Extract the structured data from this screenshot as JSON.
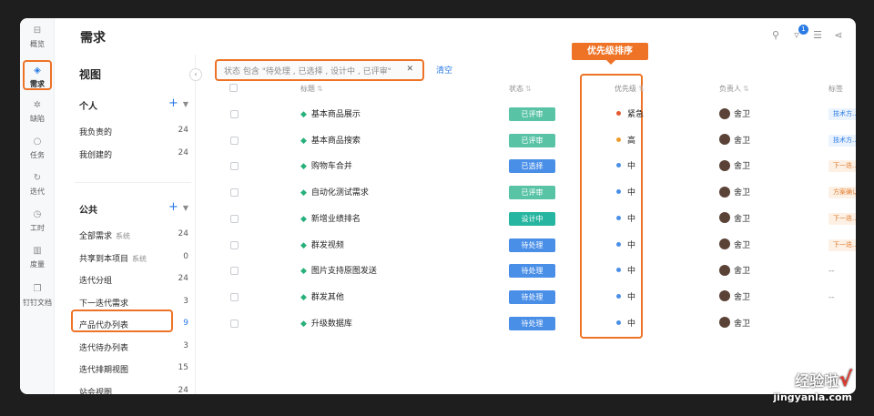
{
  "rail": [
    {
      "label": "概览",
      "icon": "overview-icon",
      "glyph": "⊟"
    },
    {
      "label": "需求",
      "icon": "requirements-layers-icon",
      "glyph": "◈",
      "active": true
    },
    {
      "label": "缺陷",
      "icon": "bug-icon",
      "glyph": "✲"
    },
    {
      "label": "任务",
      "icon": "task-bulb-icon",
      "glyph": "○"
    },
    {
      "label": "迭代",
      "icon": "iteration-cycle-icon",
      "glyph": "↻"
    },
    {
      "label": "工时",
      "icon": "clock-icon",
      "glyph": "◷"
    },
    {
      "label": "度量",
      "icon": "metrics-chart-icon",
      "glyph": "▥"
    },
    {
      "label": "钉钉文档",
      "icon": "document-icon",
      "glyph": "❐"
    }
  ],
  "header": {
    "title": "需求",
    "notification_count": "1"
  },
  "views": {
    "title": "视图",
    "personal": {
      "label": "个人",
      "items": [
        {
          "label": "我负责的",
          "count": "24"
        },
        {
          "label": "我创建的",
          "count": "24"
        }
      ]
    },
    "public": {
      "label": "公共",
      "items": [
        {
          "label": "全部需求",
          "tag": "系统",
          "count": "24"
        },
        {
          "label": "共享到本项目",
          "tag": "系统",
          "count": "0"
        },
        {
          "label": "迭代分组",
          "count": "24"
        },
        {
          "label": "下一迭代需求",
          "count": "3"
        },
        {
          "label": "产品代办列表",
          "count": "9",
          "active": true
        },
        {
          "label": "迭代待办列表",
          "count": "3"
        },
        {
          "label": "迭代排期视图",
          "count": "15"
        },
        {
          "label": "站会视图",
          "count": "24"
        }
      ]
    }
  },
  "filter": {
    "text": "状态 包含 \"待处理 , 已选择 , 设计中 , 已评审\"",
    "clear_label": "清空"
  },
  "callout": "优先级排序",
  "columns": {
    "title": "标题",
    "status": "状态",
    "priority": "优先级",
    "owner": "负责人",
    "tags": "标签"
  },
  "colors": {
    "accent": "#2a7be4",
    "highlight": "#ee7326",
    "reviewed": "#59c3a6",
    "selected": "#4a8fe7",
    "designing": "#26b5a0",
    "pending": "#4a8fe7"
  },
  "rows": [
    {
      "title": "基本商品展示",
      "status": "已评审",
      "status_color": "#59c3a6",
      "priority": "紧急",
      "priority_color": "#e2592f",
      "owner": "舍卫",
      "tag": "技术方...",
      "tag_style": "blue"
    },
    {
      "title": "基本商品搜索",
      "status": "已评审",
      "status_color": "#59c3a6",
      "priority": "高",
      "priority_color": "#ef9c2e",
      "owner": "舍卫",
      "tag": "技术方...",
      "tag_style": "blue"
    },
    {
      "title": "购物车合并",
      "status": "已选择",
      "status_color": "#4a8fe7",
      "priority": "中",
      "priority_color": "#4a8fe7",
      "owner": "舍卫",
      "tag": "下一迭...",
      "tag_style": "orange"
    },
    {
      "title": "自动化测试需求",
      "status": "已评审",
      "status_color": "#59c3a6",
      "priority": "中",
      "priority_color": "#4a8fe7",
      "owner": "舍卫",
      "tag": "方案确认",
      "tag_style": "orange"
    },
    {
      "title": "新增业绩排名",
      "status": "设计中",
      "status_color": "#26b5a0",
      "priority": "中",
      "priority_color": "#4a8fe7",
      "owner": "舍卫",
      "tag": "下一迭...",
      "tag_style": "orange"
    },
    {
      "title": "群发视频",
      "status": "待处理",
      "status_color": "#4a8fe7",
      "priority": "中",
      "priority_color": "#4a8fe7",
      "owner": "舍卫",
      "tag": "下一迭...",
      "tag_style": "orange"
    },
    {
      "title": "图片支持原图发送",
      "status": "待处理",
      "status_color": "#4a8fe7",
      "priority": "中",
      "priority_color": "#4a8fe7",
      "owner": "舍卫",
      "tag": "--",
      "tag_style": "none"
    },
    {
      "title": "群发其他",
      "status": "待处理",
      "status_color": "#4a8fe7",
      "priority": "中",
      "priority_color": "#4a8fe7",
      "owner": "舍卫",
      "tag": "--",
      "tag_style": "none"
    },
    {
      "title": "升级数据库",
      "status": "待处理",
      "status_color": "#4a8fe7",
      "priority": "中",
      "priority_color": "#4a8fe7",
      "owner": "舍卫",
      "tag": "",
      "tag_style": "none"
    }
  ],
  "watermark": {
    "cn": "经验啦",
    "en": "jingyanla.com",
    "check": "√"
  }
}
